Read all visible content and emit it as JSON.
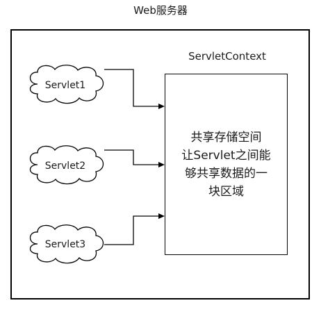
{
  "diagram": {
    "title": "Web服务器",
    "context_label": "ServletContext",
    "context_text": "共享存储空间\n让Servlet之间能\n够共享数据的一\n块区域",
    "servlets": [
      "Servlet1",
      "Servlet2",
      "Servlet3"
    ]
  }
}
